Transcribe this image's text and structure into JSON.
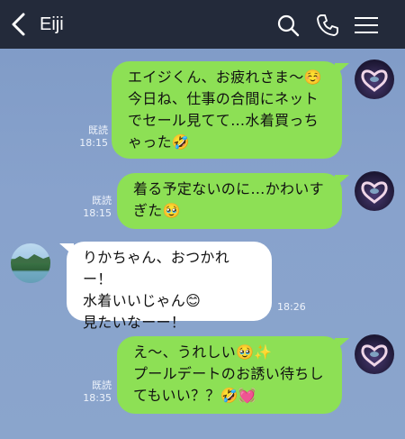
{
  "header": {
    "contact_name": "Eiji",
    "icons": [
      "back-chevron-icon",
      "search-icon",
      "phone-icon",
      "menu-icon"
    ]
  },
  "messages": [
    {
      "direction": "outgoing",
      "text": "エイジくん、お疲れさま〜☺️\n今日ね、仕事の合間にネット\nでセール見てて…水着買っち\nゃった🤣",
      "read_label": "既読",
      "time": "18:15"
    },
    {
      "direction": "outgoing",
      "text": "着る予定ないのに…かわいす\nぎた🥹",
      "read_label": "既読",
      "time": "18:15"
    },
    {
      "direction": "incoming",
      "text": "りかちゃん、おつかれー！\n水着いいじゃん😊\n見たいなーー！",
      "time": "18:26"
    },
    {
      "direction": "outgoing",
      "text": "え〜、うれしい🥹✨\nプールデートのお誘い待ちし\nてもいい？？🤣💓",
      "read_label": "既読",
      "time": "18:35"
    }
  ],
  "colors": {
    "header_bg": "#232a3a",
    "chat_bg": "#86a0ca",
    "outgoing_bubble": "#8de055",
    "incoming_bubble": "#ffffff"
  }
}
